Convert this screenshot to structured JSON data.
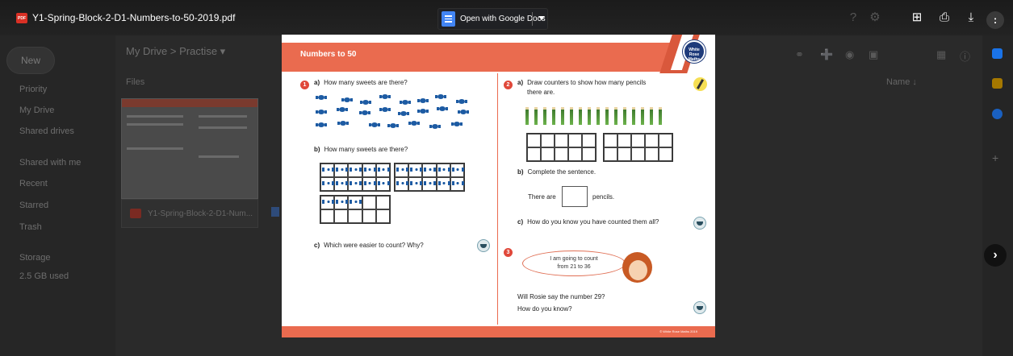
{
  "viewer": {
    "file_name": "Y1-Spring-Block-2-D1-Numbers-to-50-2019.pdf",
    "file_badge": "PDF",
    "open_with_label": "Open with Google Docs",
    "avatar_letter": ":",
    "icons": [
      "add-comment-icon",
      "print-icon",
      "download-icon",
      "more-icon"
    ]
  },
  "drive_background": {
    "new_label": "New",
    "breadcrumb": "My Drive  >  Practise  ▾",
    "files_header": "Files",
    "name_column": "Name  ↓",
    "nav": [
      "Priority",
      "My Drive",
      "Shared drives",
      "Shared with me",
      "Recent",
      "Starred",
      "Trash",
      "Storage",
      "2.5 GB used"
    ],
    "file_card": "Y1-Spring-Block-2-D1-Num..."
  },
  "page": {
    "ribbon_title": "Numbers to 50",
    "logo_text": "White Rose Maths",
    "footer": "© White Rose Maths 2019",
    "q1": {
      "num": "1",
      "a_letter": "a)",
      "a_text": "How many sweets are there?",
      "b_letter": "b)",
      "b_text": "How many sweets are there?",
      "c_letter": "c)",
      "c_text": "Which were easier to count? Why?"
    },
    "q2": {
      "num": "2",
      "a_letter": "a)",
      "a_text": "Draw counters to show how many pencils",
      "a_text2": "there are.",
      "b_letter": "b)",
      "b_text": "Complete the sentence.",
      "sentence_start": "There are",
      "sentence_end": "pencils.",
      "c_letter": "c)",
      "c_text": "How do you know you have counted them all?"
    },
    "q3": {
      "num": "3",
      "bubble_line1": "I am going to count",
      "bubble_line2": "from 21 to 36",
      "question_line1": "Will Rosie say the number 29?",
      "question_line2": "How do you know?"
    }
  }
}
